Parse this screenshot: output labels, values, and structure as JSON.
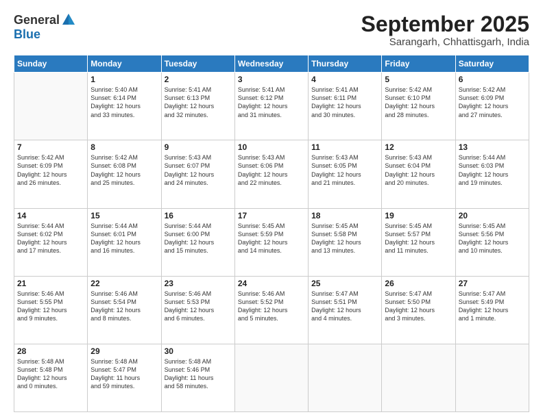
{
  "logo": {
    "general": "General",
    "blue": "Blue"
  },
  "header": {
    "month": "September 2025",
    "location": "Sarangarh, Chhattisgarh, India"
  },
  "days_of_week": [
    "Sunday",
    "Monday",
    "Tuesday",
    "Wednesday",
    "Thursday",
    "Friday",
    "Saturday"
  ],
  "weeks": [
    [
      {
        "day": "",
        "info": ""
      },
      {
        "day": "1",
        "info": "Sunrise: 5:40 AM\nSunset: 6:14 PM\nDaylight: 12 hours\nand 33 minutes."
      },
      {
        "day": "2",
        "info": "Sunrise: 5:41 AM\nSunset: 6:13 PM\nDaylight: 12 hours\nand 32 minutes."
      },
      {
        "day": "3",
        "info": "Sunrise: 5:41 AM\nSunset: 6:12 PM\nDaylight: 12 hours\nand 31 minutes."
      },
      {
        "day": "4",
        "info": "Sunrise: 5:41 AM\nSunset: 6:11 PM\nDaylight: 12 hours\nand 30 minutes."
      },
      {
        "day": "5",
        "info": "Sunrise: 5:42 AM\nSunset: 6:10 PM\nDaylight: 12 hours\nand 28 minutes."
      },
      {
        "day": "6",
        "info": "Sunrise: 5:42 AM\nSunset: 6:09 PM\nDaylight: 12 hours\nand 27 minutes."
      }
    ],
    [
      {
        "day": "7",
        "info": "Sunrise: 5:42 AM\nSunset: 6:09 PM\nDaylight: 12 hours\nand 26 minutes."
      },
      {
        "day": "8",
        "info": "Sunrise: 5:42 AM\nSunset: 6:08 PM\nDaylight: 12 hours\nand 25 minutes."
      },
      {
        "day": "9",
        "info": "Sunrise: 5:43 AM\nSunset: 6:07 PM\nDaylight: 12 hours\nand 24 minutes."
      },
      {
        "day": "10",
        "info": "Sunrise: 5:43 AM\nSunset: 6:06 PM\nDaylight: 12 hours\nand 22 minutes."
      },
      {
        "day": "11",
        "info": "Sunrise: 5:43 AM\nSunset: 6:05 PM\nDaylight: 12 hours\nand 21 minutes."
      },
      {
        "day": "12",
        "info": "Sunrise: 5:43 AM\nSunset: 6:04 PM\nDaylight: 12 hours\nand 20 minutes."
      },
      {
        "day": "13",
        "info": "Sunrise: 5:44 AM\nSunset: 6:03 PM\nDaylight: 12 hours\nand 19 minutes."
      }
    ],
    [
      {
        "day": "14",
        "info": "Sunrise: 5:44 AM\nSunset: 6:02 PM\nDaylight: 12 hours\nand 17 minutes."
      },
      {
        "day": "15",
        "info": "Sunrise: 5:44 AM\nSunset: 6:01 PM\nDaylight: 12 hours\nand 16 minutes."
      },
      {
        "day": "16",
        "info": "Sunrise: 5:44 AM\nSunset: 6:00 PM\nDaylight: 12 hours\nand 15 minutes."
      },
      {
        "day": "17",
        "info": "Sunrise: 5:45 AM\nSunset: 5:59 PM\nDaylight: 12 hours\nand 14 minutes."
      },
      {
        "day": "18",
        "info": "Sunrise: 5:45 AM\nSunset: 5:58 PM\nDaylight: 12 hours\nand 13 minutes."
      },
      {
        "day": "19",
        "info": "Sunrise: 5:45 AM\nSunset: 5:57 PM\nDaylight: 12 hours\nand 11 minutes."
      },
      {
        "day": "20",
        "info": "Sunrise: 5:45 AM\nSunset: 5:56 PM\nDaylight: 12 hours\nand 10 minutes."
      }
    ],
    [
      {
        "day": "21",
        "info": "Sunrise: 5:46 AM\nSunset: 5:55 PM\nDaylight: 12 hours\nand 9 minutes."
      },
      {
        "day": "22",
        "info": "Sunrise: 5:46 AM\nSunset: 5:54 PM\nDaylight: 12 hours\nand 8 minutes."
      },
      {
        "day": "23",
        "info": "Sunrise: 5:46 AM\nSunset: 5:53 PM\nDaylight: 12 hours\nand 6 minutes."
      },
      {
        "day": "24",
        "info": "Sunrise: 5:46 AM\nSunset: 5:52 PM\nDaylight: 12 hours\nand 5 minutes."
      },
      {
        "day": "25",
        "info": "Sunrise: 5:47 AM\nSunset: 5:51 PM\nDaylight: 12 hours\nand 4 minutes."
      },
      {
        "day": "26",
        "info": "Sunrise: 5:47 AM\nSunset: 5:50 PM\nDaylight: 12 hours\nand 3 minutes."
      },
      {
        "day": "27",
        "info": "Sunrise: 5:47 AM\nSunset: 5:49 PM\nDaylight: 12 hours\nand 1 minute."
      }
    ],
    [
      {
        "day": "28",
        "info": "Sunrise: 5:48 AM\nSunset: 5:48 PM\nDaylight: 12 hours\nand 0 minutes."
      },
      {
        "day": "29",
        "info": "Sunrise: 5:48 AM\nSunset: 5:47 PM\nDaylight: 11 hours\nand 59 minutes."
      },
      {
        "day": "30",
        "info": "Sunrise: 5:48 AM\nSunset: 5:46 PM\nDaylight: 11 hours\nand 58 minutes."
      },
      {
        "day": "",
        "info": ""
      },
      {
        "day": "",
        "info": ""
      },
      {
        "day": "",
        "info": ""
      },
      {
        "day": "",
        "info": ""
      }
    ]
  ]
}
